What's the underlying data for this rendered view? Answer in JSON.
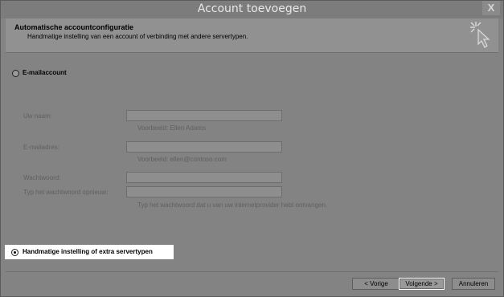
{
  "window": {
    "title": "Account toevoegen",
    "close_symbol": "X"
  },
  "header": {
    "title": "Automatische accountconfiguratie",
    "subtitle": "Handmatige instelling van een account of verbinding met andere servertypen.",
    "icon": "wand-cursor-icon"
  },
  "options": {
    "email_account": {
      "label": "E-mailaccount",
      "selected": false
    },
    "manual": {
      "label": "Handmatige instelling of extra servertypen",
      "selected": true
    }
  },
  "form": {
    "name": {
      "label": "Uw naam:",
      "value": "",
      "hint": "Voorbeeld: Ellen Adams"
    },
    "email": {
      "label": "E-mailadres:",
      "value": "",
      "hint": "Voorbeeld: ellen@contoso.com"
    },
    "password": {
      "label": "Wachtwoord:",
      "value": ""
    },
    "password_repeat": {
      "label": "Typ het wachtwoord opnieuw:",
      "value": "",
      "hint": "Typ het wachtwoord dat u van uw internetprovider hebt ontvangen."
    }
  },
  "buttons": {
    "back": "< Vorige",
    "next": "Volgende >",
    "cancel": "Annuleren"
  },
  "colors": {
    "dim_background": "#838383",
    "highlight": "#ffffff"
  }
}
